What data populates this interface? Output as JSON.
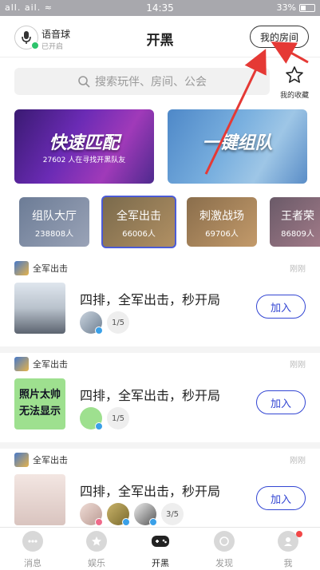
{
  "status_bar": {
    "carrier": "all. ail. ≈",
    "time": "14:35",
    "battery": "33%"
  },
  "header": {
    "voice_ball_title": "语音球",
    "voice_ball_status": "已开启",
    "title": "开黑",
    "my_room_label": "我的房间"
  },
  "search": {
    "placeholder": "搜索玩伴、房间、公会"
  },
  "favorites": {
    "label": "我的收藏"
  },
  "banners": [
    {
      "title": "快速匹配",
      "subtitle": "27602 人在寻找开黑队友"
    },
    {
      "title": "一键组队",
      "subtitle": ""
    }
  ],
  "categories": [
    {
      "name": "组队大厅",
      "count": "238808人"
    },
    {
      "name": "全军出击",
      "count": "66006人"
    },
    {
      "name": "刺激战场",
      "count": "69706人"
    },
    {
      "name": "王者荣",
      "count": "86809人"
    }
  ],
  "posts": [
    {
      "game": "全军出击",
      "time": "刚刚",
      "title": "四排，全军出击，秒开局",
      "slots": "1/5",
      "join": "加入"
    },
    {
      "game": "全军出击",
      "time": "刚刚",
      "title": "四排，全军出击，秒开局",
      "slots": "1/5",
      "join": "加入",
      "thumb_text": "照片太帅无法显示"
    },
    {
      "game": "全军出击",
      "time": "刚刚",
      "title": "四排，全军出击，秒开局",
      "slots": "3/5",
      "join": "加入"
    }
  ],
  "tabbar": {
    "items": [
      "消息",
      "娱乐",
      "开黑",
      "发现",
      "我"
    ],
    "active": "开黑"
  },
  "colors": {
    "accent": "#3346d3",
    "status_bar": "#a8a8ad",
    "annotation_arrow": "#e53935"
  }
}
